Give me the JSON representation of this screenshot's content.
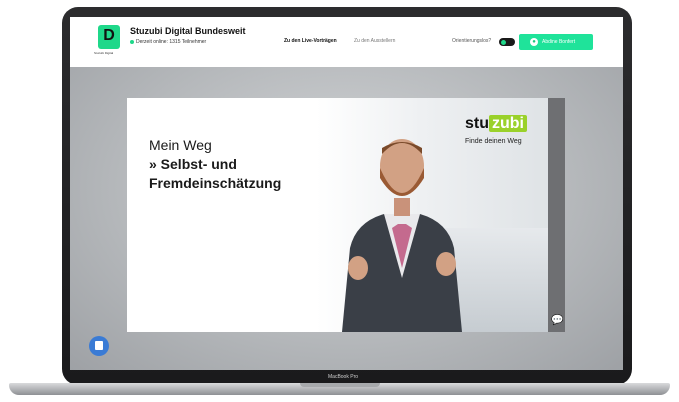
{
  "device": {
    "label": "MacBook Pro"
  },
  "header": {
    "logo_letter": "D",
    "logo_caption": "Stuzubi Digital",
    "title": "Stuzubi Digital Bundesweit",
    "online_status": "Derzeit online: 1315 Teilnehmer",
    "nav": {
      "live": "Zu den Live-Vorträgen",
      "exhibitors": "Zu den Ausstellern"
    },
    "orientation_label": "Orientierungslos?",
    "orientation_toggle_on": true,
    "login_label": "Abdine Bonfert"
  },
  "video": {
    "line1": "Mein Weg",
    "line2": "» Selbst- und",
    "line3": "Fremdeinschätzung",
    "logo_part1": "stu",
    "logo_part2": "zubi",
    "tagline": "Finde deinen Weg"
  },
  "colors": {
    "accent": "#1fd88a",
    "brand_green": "#9ad12a",
    "help_button": "#3a7bd5"
  },
  "icons": {
    "chat": "chat-bubbles-icon",
    "help": "chat-help-icon",
    "login": "user-icon"
  }
}
